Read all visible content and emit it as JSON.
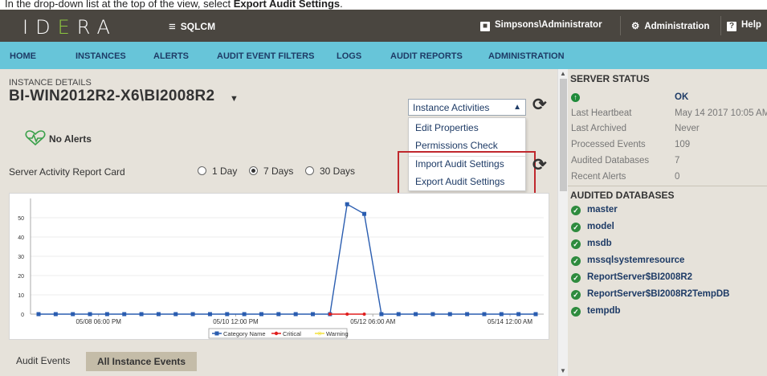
{
  "caption": {
    "prefix": "In the drop-down list at the top of the view, select ",
    "bold": "Export Audit Settings",
    "suffix": "."
  },
  "topbar": {
    "logo": "IDERA",
    "product": "SQLCM",
    "user": "Simpsons\\Administrator",
    "admin": "Administration",
    "help": "Help"
  },
  "nav": [
    "HOME",
    "INSTANCES",
    "ALERTS",
    "AUDIT EVENT FILTERS",
    "LOGS",
    "AUDIT REPORTS",
    "ADMINISTRATION"
  ],
  "instance": {
    "label": "INSTANCE DETAILS",
    "name": "BI-WIN2012R2-X6\\BI2008R2",
    "alerts": "No Alerts"
  },
  "activities": {
    "selected": "Instance Activities",
    "items": [
      "Edit Properties",
      "Permissions Check",
      "Import Audit Settings",
      "Export Audit Settings"
    ]
  },
  "report_card": {
    "label": "Server Activity Report Card",
    "options": [
      "1 Day",
      "7 Days",
      "30 Days"
    ],
    "selected": "7 Days"
  },
  "chart_data": {
    "type": "line",
    "x_ticks": [
      "05/08 06:00 PM",
      "05/10 12:00 PM",
      "05/12 06:00 AM",
      "05/14 12:00 AM"
    ],
    "y_ticks": [
      0,
      10,
      20,
      30,
      40,
      50
    ],
    "ylim": [
      0,
      60
    ],
    "series": [
      {
        "name": "Category Name",
        "color": "#2a5db0",
        "values": [
          0,
          0,
          0,
          0,
          0,
          0,
          0,
          0,
          0,
          0,
          0,
          0,
          0,
          0,
          0,
          0,
          0,
          0,
          57,
          52,
          0,
          0,
          0,
          0,
          0,
          0,
          0,
          0,
          0,
          0
        ]
      },
      {
        "name": "Critical",
        "color": "#e01e1e",
        "values": [
          null,
          null,
          null,
          null,
          null,
          null,
          null,
          null,
          null,
          null,
          null,
          null,
          null,
          null,
          null,
          null,
          null,
          0,
          0,
          0,
          null,
          null,
          null,
          null,
          null,
          null,
          null,
          null,
          null,
          null
        ]
      },
      {
        "name": "Warning",
        "color": "#f2e13a",
        "values": []
      }
    ],
    "grid": true,
    "legend": "bottom"
  },
  "tabs": {
    "audit_events": "Audit Events",
    "all_events": "All Instance Events"
  },
  "server_status": {
    "title": "SERVER STATUS",
    "status": "OK",
    "rows": [
      {
        "label": "Last Heartbeat",
        "value": "May 14 2017 10:05 AM"
      },
      {
        "label": "Last Archived",
        "value": "Never"
      },
      {
        "label": "Processed Events",
        "value": "109"
      },
      {
        "label": "Audited Databases",
        "value": "7"
      },
      {
        "label": "Recent Alerts",
        "value": "0"
      }
    ]
  },
  "audited_databases": {
    "title": "AUDITED DATABASES",
    "items": [
      "master",
      "model",
      "msdb",
      "mssqlsystemresource",
      "ReportServer$BI2008R2",
      "ReportServer$BI2008R2TempDB",
      "tempdb"
    ]
  }
}
